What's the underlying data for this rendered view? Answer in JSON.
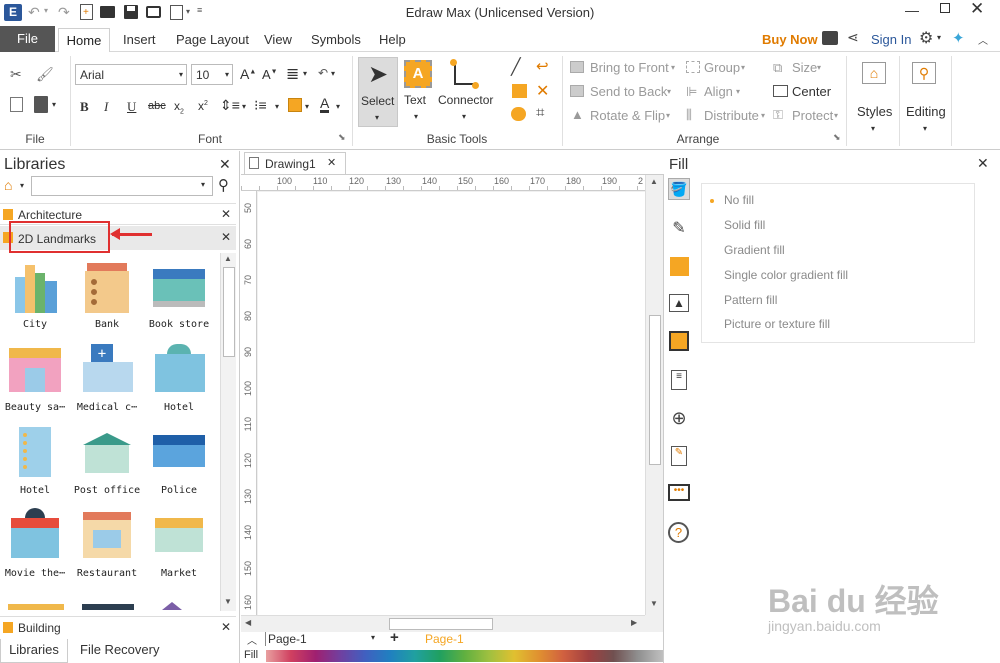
{
  "app": {
    "title": "Edraw Max (Unlicensed Version)"
  },
  "menu": {
    "file": "File",
    "tabs": [
      "Home",
      "Insert",
      "Page Layout",
      "View",
      "Symbols",
      "Help"
    ],
    "buy_now": "Buy Now",
    "sign_in": "Sign In"
  },
  "ribbon": {
    "groups": {
      "file": "File",
      "font": "Font",
      "basic_tools": "Basic Tools",
      "arrange": "Arrange"
    },
    "font_name": "Arial",
    "font_size": "10",
    "select": "Select",
    "text": "Text",
    "connector": "Connector",
    "bring_to_front": "Bring to Front",
    "send_to_back": "Send to Back",
    "rotate_flip": "Rotate & Flip",
    "group": "Group",
    "align": "Align",
    "distribute": "Distribute",
    "size": "Size",
    "center": "Center",
    "protect": "Protect",
    "styles": "Styles",
    "editing": "Editing"
  },
  "libraries": {
    "title": "Libraries",
    "search_placeholder": "",
    "categories": [
      "Architecture",
      "2D Landmarks"
    ],
    "items": [
      "City",
      "Bank",
      "Book store",
      "Beauty sa⋯",
      "Medical c⋯",
      "Hotel",
      "Hotel",
      "Post office",
      "Police",
      "Movie the⋯",
      "Restaurant",
      "Market"
    ],
    "building": "Building",
    "bottom_tabs": [
      "Libraries",
      "File Recovery"
    ]
  },
  "document": {
    "tab": "Drawing1",
    "ruler_h": [
      "100",
      "110",
      "120",
      "130",
      "140",
      "150",
      "160",
      "170",
      "180",
      "190",
      "2"
    ],
    "ruler_v": [
      "50",
      "60",
      "70",
      "80",
      "90",
      "100",
      "110",
      "120",
      "130",
      "140",
      "150",
      "160"
    ],
    "page_select": "Page-1",
    "page_tab": "Page-1",
    "fill_label": "Fill"
  },
  "fill_panel": {
    "title": "Fill",
    "options": [
      "No fill",
      "Solid fill",
      "Gradient fill",
      "Single color gradient fill",
      "Pattern fill",
      "Picture or texture fill"
    ]
  },
  "watermark": {
    "logo": "Bai du 经验",
    "url": "jingyan.baidu.com"
  },
  "colors": {
    "accent": "#2b579a",
    "buy_now": "#e07b00",
    "highlight": "#e03030",
    "orange": "#f5a623"
  }
}
